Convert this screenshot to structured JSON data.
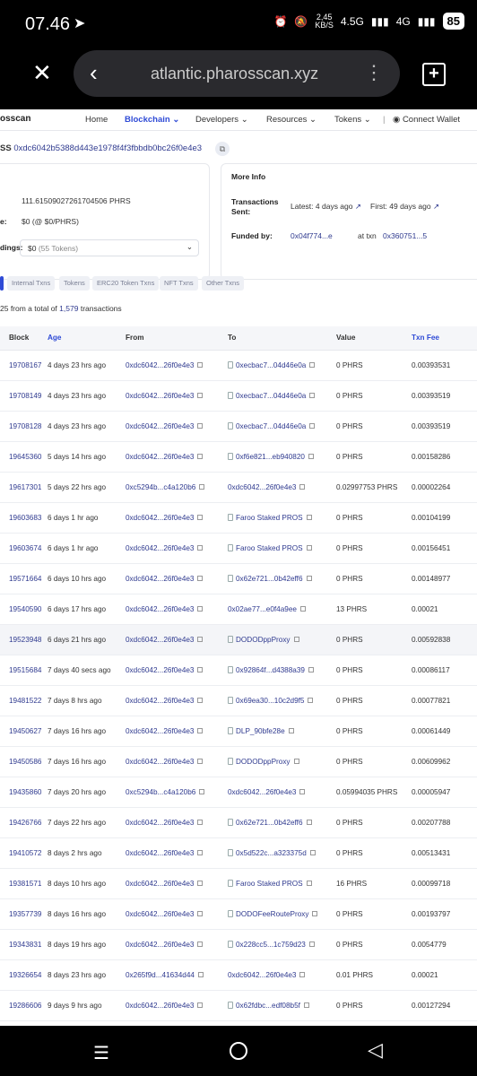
{
  "status": {
    "time": "07.46",
    "net_speed": "2,45",
    "net_unit": "KB/S",
    "net1": "4.5G",
    "net2": "4G",
    "battery": "85"
  },
  "browser": {
    "url": "atlantic.pharosscan.xyz"
  },
  "nav": {
    "brand": "osscan",
    "items": [
      "Home",
      "Blockchain",
      "Developers",
      "Resources",
      "Tokens",
      "Connect Wallet"
    ]
  },
  "address": {
    "prefix": "SS",
    "value": "0xdc6042b5388d443e1978f4f3fbbdb0bc26f0e4e3"
  },
  "overview": {
    "balance": "111.61509027261704506 PHRS",
    "value_label": "e:",
    "value": "$0 (@ $0/PHRS)",
    "holdings_label": "dings:",
    "holdings": "$0",
    "holdings_tokens": "(55 Tokens)"
  },
  "more_info": {
    "title": "More Info",
    "tx_sent_label": "Transactions Sent:",
    "latest_label": "Latest:",
    "latest": "4 days ago",
    "first_label": "First:",
    "first": "49 days ago",
    "funded_label": "Funded by:",
    "funded_addr": "0x04f774...e",
    "at_txn_label": "at txn",
    "funded_txn": "0x360751...5"
  },
  "tabs": [
    "Internal Txns",
    "Tokens",
    "ERC20 Token Txns",
    "NFT Txns",
    "Other Txns"
  ],
  "summary": {
    "prefix": "25 from a total of",
    "count": "1,579",
    "suffix": "transactions"
  },
  "table": {
    "headers": [
      "Block",
      "Age",
      "From",
      "To",
      "Value",
      "Txn Fee"
    ],
    "rows": [
      {
        "block": "19708167",
        "age": "4 days 23 hrs ago",
        "from": "0xdc6042...26f0e4e3",
        "to": "0xecbac7...04d46e0a",
        "to_contract": true,
        "value": "0 PHRS",
        "fee": "0.00393531"
      },
      {
        "block": "19708149",
        "age": "4 days 23 hrs ago",
        "from": "0xdc6042...26f0e4e3",
        "to": "0xecbac7...04d46e0a",
        "to_contract": true,
        "value": "0 PHRS",
        "fee": "0.00393519"
      },
      {
        "block": "19708128",
        "age": "4 days 23 hrs ago",
        "from": "0xdc6042...26f0e4e3",
        "to": "0xecbac7...04d46e0a",
        "to_contract": true,
        "value": "0 PHRS",
        "fee": "0.00393519"
      },
      {
        "block": "19645360",
        "age": "5 days 14 hrs ago",
        "from": "0xdc6042...26f0e4e3",
        "to": "0xf6e821...eb940820",
        "to_contract": true,
        "value": "0 PHRS",
        "fee": "0.00158286"
      },
      {
        "block": "19617301",
        "age": "5 days 22 hrs ago",
        "from": "0xc5294b...c4a120b6",
        "to": "0xdc6042...26f0e4e3",
        "to_contract": false,
        "value": "0.02997753 PHRS",
        "fee": "0.00002264"
      },
      {
        "block": "19603683",
        "age": "6 days 1 hr ago",
        "from": "0xdc6042...26f0e4e3",
        "to": "Faroo Staked PROS",
        "to_contract": true,
        "value": "0 PHRS",
        "fee": "0.00104199"
      },
      {
        "block": "19603674",
        "age": "6 days 1 hr ago",
        "from": "0xdc6042...26f0e4e3",
        "to": "Faroo Staked PROS",
        "to_contract": true,
        "value": "0 PHRS",
        "fee": "0.00156451"
      },
      {
        "block": "19571664",
        "age": "6 days 10 hrs ago",
        "from": "0xdc6042...26f0e4e3",
        "to": "0x62e721...0b42eff6",
        "to_contract": true,
        "value": "0 PHRS",
        "fee": "0.00148977"
      },
      {
        "block": "19540590",
        "age": "6 days 17 hrs ago",
        "from": "0xdc6042...26f0e4e3",
        "to": "0x02ae77...e0f4a9ee",
        "to_contract": false,
        "value": "13 PHRS",
        "fee": "0.00021"
      },
      {
        "block": "19523948",
        "age": "6 days 21 hrs ago",
        "from": "0xdc6042...26f0e4e3",
        "to": "DODODppProxy",
        "to_contract": true,
        "value": "0 PHRS",
        "fee": "0.00592838"
      },
      {
        "block": "19515684",
        "age": "7 days 40 secs ago",
        "from": "0xdc6042...26f0e4e3",
        "to": "0x92864f...d4388a39",
        "to_contract": true,
        "value": "0 PHRS",
        "fee": "0.00086117"
      },
      {
        "block": "19481522",
        "age": "7 days 8 hrs ago",
        "from": "0xdc6042...26f0e4e3",
        "to": "0x69ea30...10c2d9f5",
        "to_contract": true,
        "value": "0 PHRS",
        "fee": "0.00077821"
      },
      {
        "block": "19450627",
        "age": "7 days 16 hrs ago",
        "from": "0xdc6042...26f0e4e3",
        "to": "DLP_90bfe28e",
        "to_contract": true,
        "value": "0 PHRS",
        "fee": "0.00061449"
      },
      {
        "block": "19450586",
        "age": "7 days 16 hrs ago",
        "from": "0xdc6042...26f0e4e3",
        "to": "DODODppProxy",
        "to_contract": true,
        "value": "0 PHRS",
        "fee": "0.00609962"
      },
      {
        "block": "19435860",
        "age": "7 days 20 hrs ago",
        "from": "0xc5294b...c4a120b6",
        "to": "0xdc6042...26f0e4e3",
        "to_contract": false,
        "value": "0.05994035 PHRS",
        "fee": "0.00005947"
      },
      {
        "block": "19426766",
        "age": "7 days 22 hrs ago",
        "from": "0xdc6042...26f0e4e3",
        "to": "0x62e721...0b42eff6",
        "to_contract": true,
        "value": "0 PHRS",
        "fee": "0.00207788"
      },
      {
        "block": "19410572",
        "age": "8 days 2 hrs ago",
        "from": "0xdc6042...26f0e4e3",
        "to": "0x5d522c...a323375d",
        "to_contract": true,
        "value": "0 PHRS",
        "fee": "0.00513431"
      },
      {
        "block": "19381571",
        "age": "8 days 10 hrs ago",
        "from": "0xdc6042...26f0e4e3",
        "to": "Faroo Staked PROS",
        "to_contract": true,
        "value": "16 PHRS",
        "fee": "0.00099718"
      },
      {
        "block": "19357739",
        "age": "8 days 16 hrs ago",
        "from": "0xdc6042...26f0e4e3",
        "to": "DODOFeeRouteProxy",
        "to_contract": true,
        "value": "0 PHRS",
        "fee": "0.00193797"
      },
      {
        "block": "19343831",
        "age": "8 days 19 hrs ago",
        "from": "0xdc6042...26f0e4e3",
        "to": "0x228cc5...1c759d23",
        "to_contract": true,
        "value": "0 PHRS",
        "fee": "0.0054779"
      },
      {
        "block": "19326654",
        "age": "8 days 23 hrs ago",
        "from": "0x265f9d...41634d44",
        "to": "0xdc6042...26f0e4e3",
        "to_contract": false,
        "value": "0.01 PHRS",
        "fee": "0.00021"
      },
      {
        "block": "19286606",
        "age": "9 days 9 hrs ago",
        "from": "0xdc6042...26f0e4e3",
        "to": "0x62fdbc...edf08b5f",
        "to_contract": true,
        "value": "0 PHRS",
        "fee": "0.00127294"
      }
    ]
  }
}
